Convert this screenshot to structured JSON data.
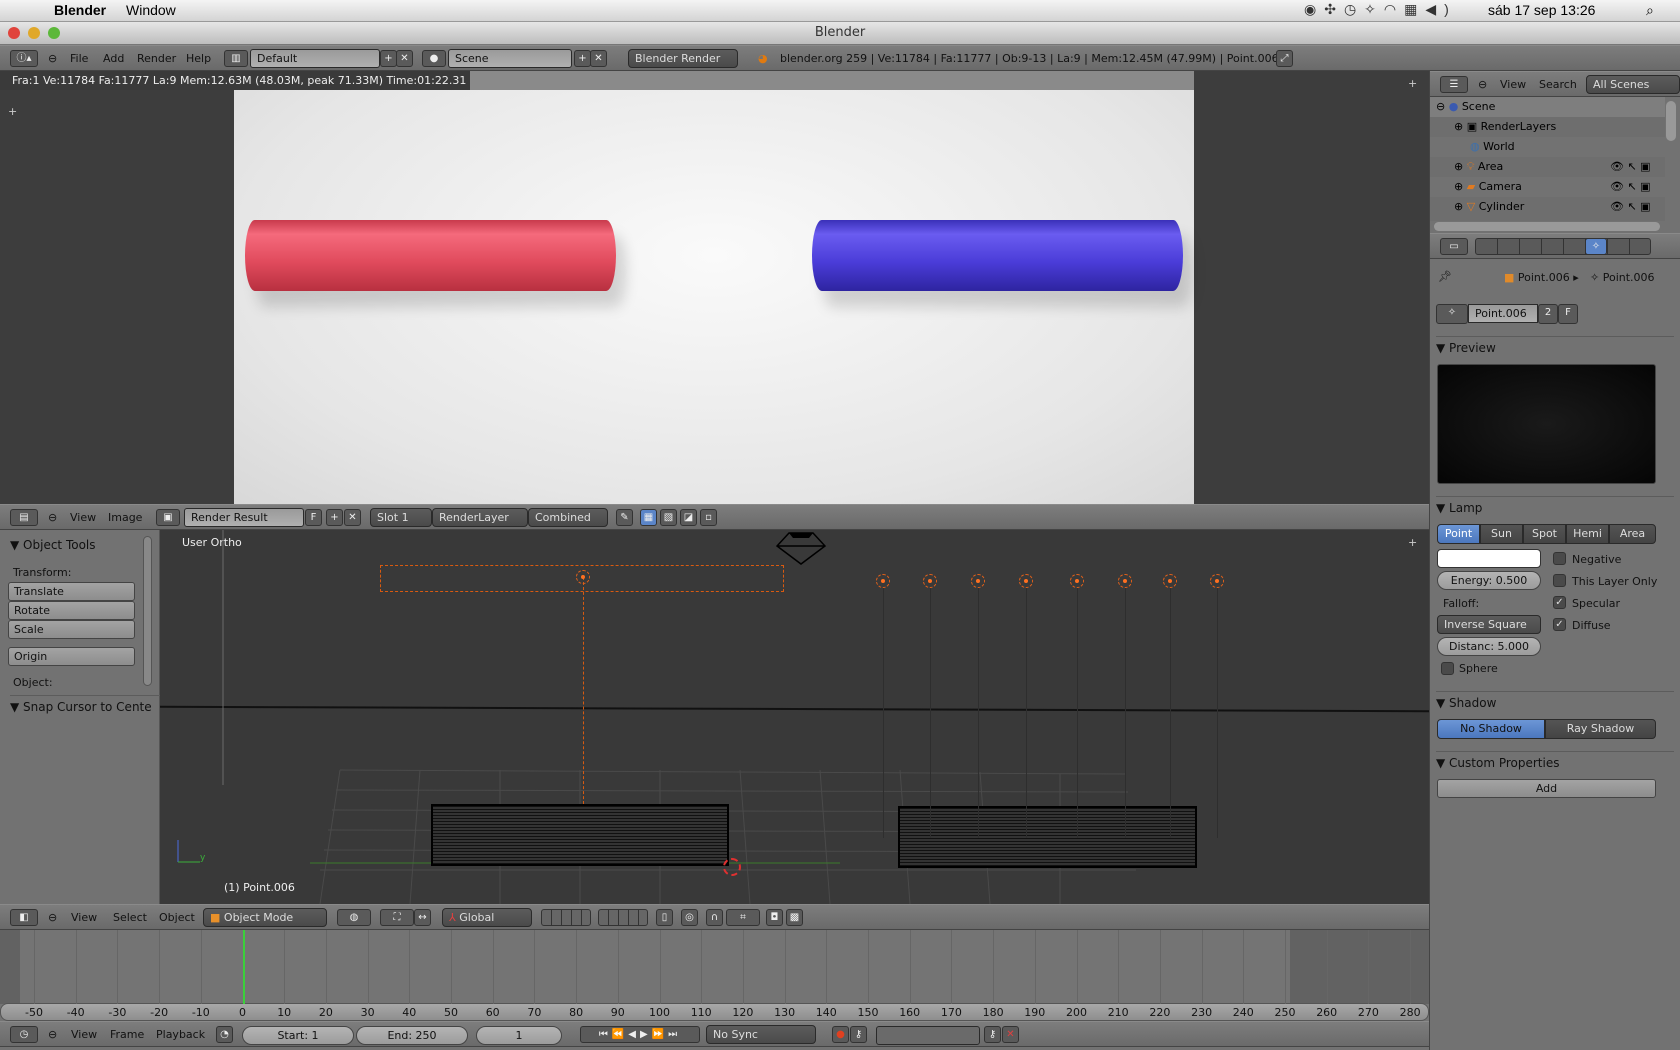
{
  "menubar": {
    "app": "Blender",
    "menu": "Window",
    "datetime": "sáb 17 sep  13:26"
  },
  "window": {
    "title": "Blender"
  },
  "info_header": {
    "menus": [
      "File",
      "Add",
      "Render",
      "Help"
    ],
    "layout": "Default",
    "scene": "Scene",
    "engine": "Blender Render",
    "stats": "blender.org 259 | Ve:11784 | Fa:11777 | Ob:9-13 | La:9 | Mem:12.45M (47.99M) | Point.006"
  },
  "image_editor": {
    "render_stats": "Fra:1  Ve:11784 Fa:11777 La:9 Mem:12.63M (48.03M, peak 71.33M) Time:01:22.31",
    "header": {
      "menus": [
        "View",
        "Image"
      ],
      "image": "Render Result",
      "fake": "F",
      "slot": "Slot 1",
      "layer": "RenderLayer",
      "pass": "Combined"
    },
    "colors": {
      "red_cylinder": "#e04a5c",
      "blue_cylinder": "#4a3cd8"
    }
  },
  "viewport": {
    "label": "User Ortho",
    "object_label": "(1) Point.006",
    "tools": {
      "title": "Object Tools",
      "transform": "Transform:",
      "buttons": [
        "Translate",
        "Rotate",
        "Scale"
      ],
      "origin": "Origin",
      "object": "Object:",
      "snap": "Snap Cursor to Cente"
    },
    "header": {
      "menus": [
        "View",
        "Select",
        "Object"
      ],
      "mode": "Object Mode",
      "orientation": "Global"
    }
  },
  "timeline": {
    "ticks": [
      -50,
      -40,
      -30,
      -20,
      -10,
      0,
      10,
      20,
      30,
      40,
      50,
      60,
      70,
      80,
      90,
      100,
      110,
      120,
      130,
      140,
      150,
      160,
      170,
      180,
      190,
      200,
      210,
      220,
      230,
      240,
      250,
      260,
      270,
      280
    ],
    "current_frame": 1,
    "header": {
      "menus": [
        "View",
        "Frame",
        "Playback"
      ],
      "start": "Start: 1",
      "end": "End: 250",
      "frame": "1",
      "sync": "No Sync"
    }
  },
  "outliner": {
    "header": {
      "menus": [
        "View",
        "Search"
      ],
      "filter": "All Scenes"
    },
    "items": [
      {
        "name": "Scene",
        "level": 0
      },
      {
        "name": "RenderLayers",
        "level": 1
      },
      {
        "name": "World",
        "level": 1
      },
      {
        "name": "Area",
        "level": 1
      },
      {
        "name": "Camera",
        "level": 1
      },
      {
        "name": "Cylinder",
        "level": 1
      }
    ]
  },
  "properties": {
    "breadcrumb": [
      "Point.006",
      "Point.006"
    ],
    "datablock": "Point.006",
    "users": "2",
    "fake": "F",
    "preview": "Preview",
    "lamp": {
      "title": "Lamp",
      "types": [
        "Point",
        "Sun",
        "Spot",
        "Hemi",
        "Area"
      ],
      "active_type": "Point",
      "energy": "Energy: 0.500",
      "falloff_label": "Falloff:",
      "falloff": "Inverse Square",
      "distance": "Distanc: 5.000",
      "sphere": "Sphere",
      "options": [
        {
          "label": "Negative",
          "checked": false
        },
        {
          "label": "This Layer Only",
          "checked": false
        },
        {
          "label": "Specular",
          "checked": true
        },
        {
          "label": "Diffuse",
          "checked": true
        }
      ]
    },
    "shadow": {
      "title": "Shadow",
      "options": [
        "No Shadow",
        "Ray Shadow"
      ]
    },
    "custom": {
      "title": "Custom Properties",
      "add": "Add"
    }
  }
}
